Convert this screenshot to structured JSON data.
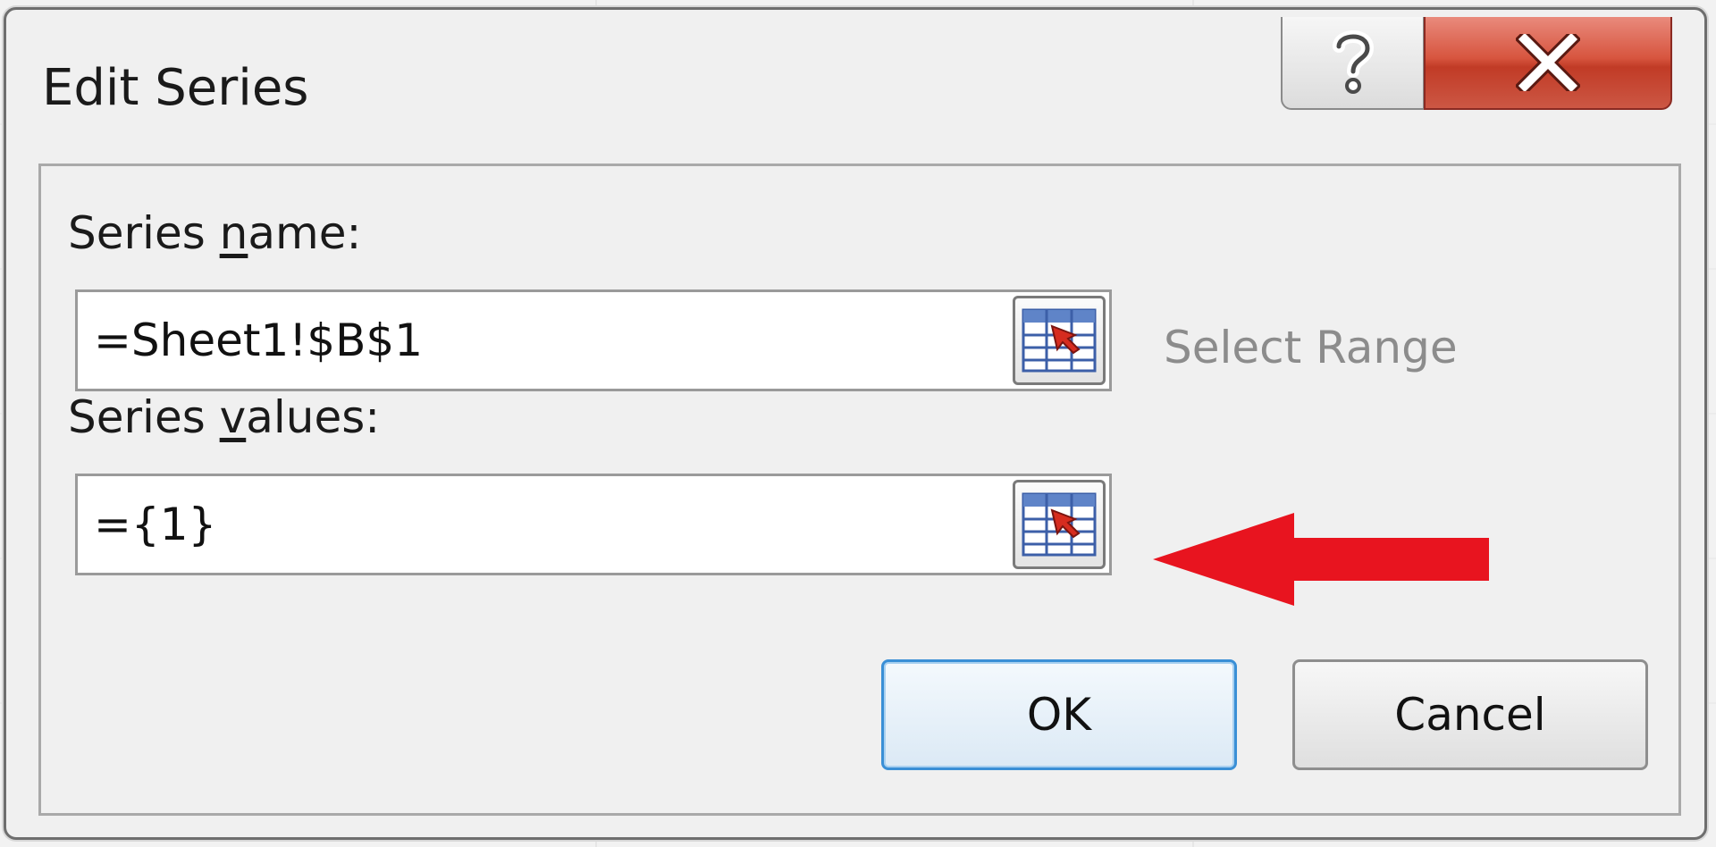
{
  "dialog": {
    "title": "Edit Series",
    "help_icon": "question-icon",
    "close_icon": "close-icon"
  },
  "series_name": {
    "label_prefix": "Series ",
    "label_accel": "n",
    "label_suffix": "ame:",
    "value": "=Sheet1!$B$1",
    "range_button_icon": "range-select-icon"
  },
  "series_values": {
    "label_prefix": "Series ",
    "label_accel": "v",
    "label_suffix": "alues:",
    "value": "={1}",
    "range_button_icon": "range-select-icon"
  },
  "select_range_text": "Select Range",
  "annotation": {
    "arrow_icon": "red-arrow-left-icon",
    "arrow_color": "#e8141f"
  },
  "buttons": {
    "ok_label": "OK",
    "cancel_label": "Cancel"
  }
}
